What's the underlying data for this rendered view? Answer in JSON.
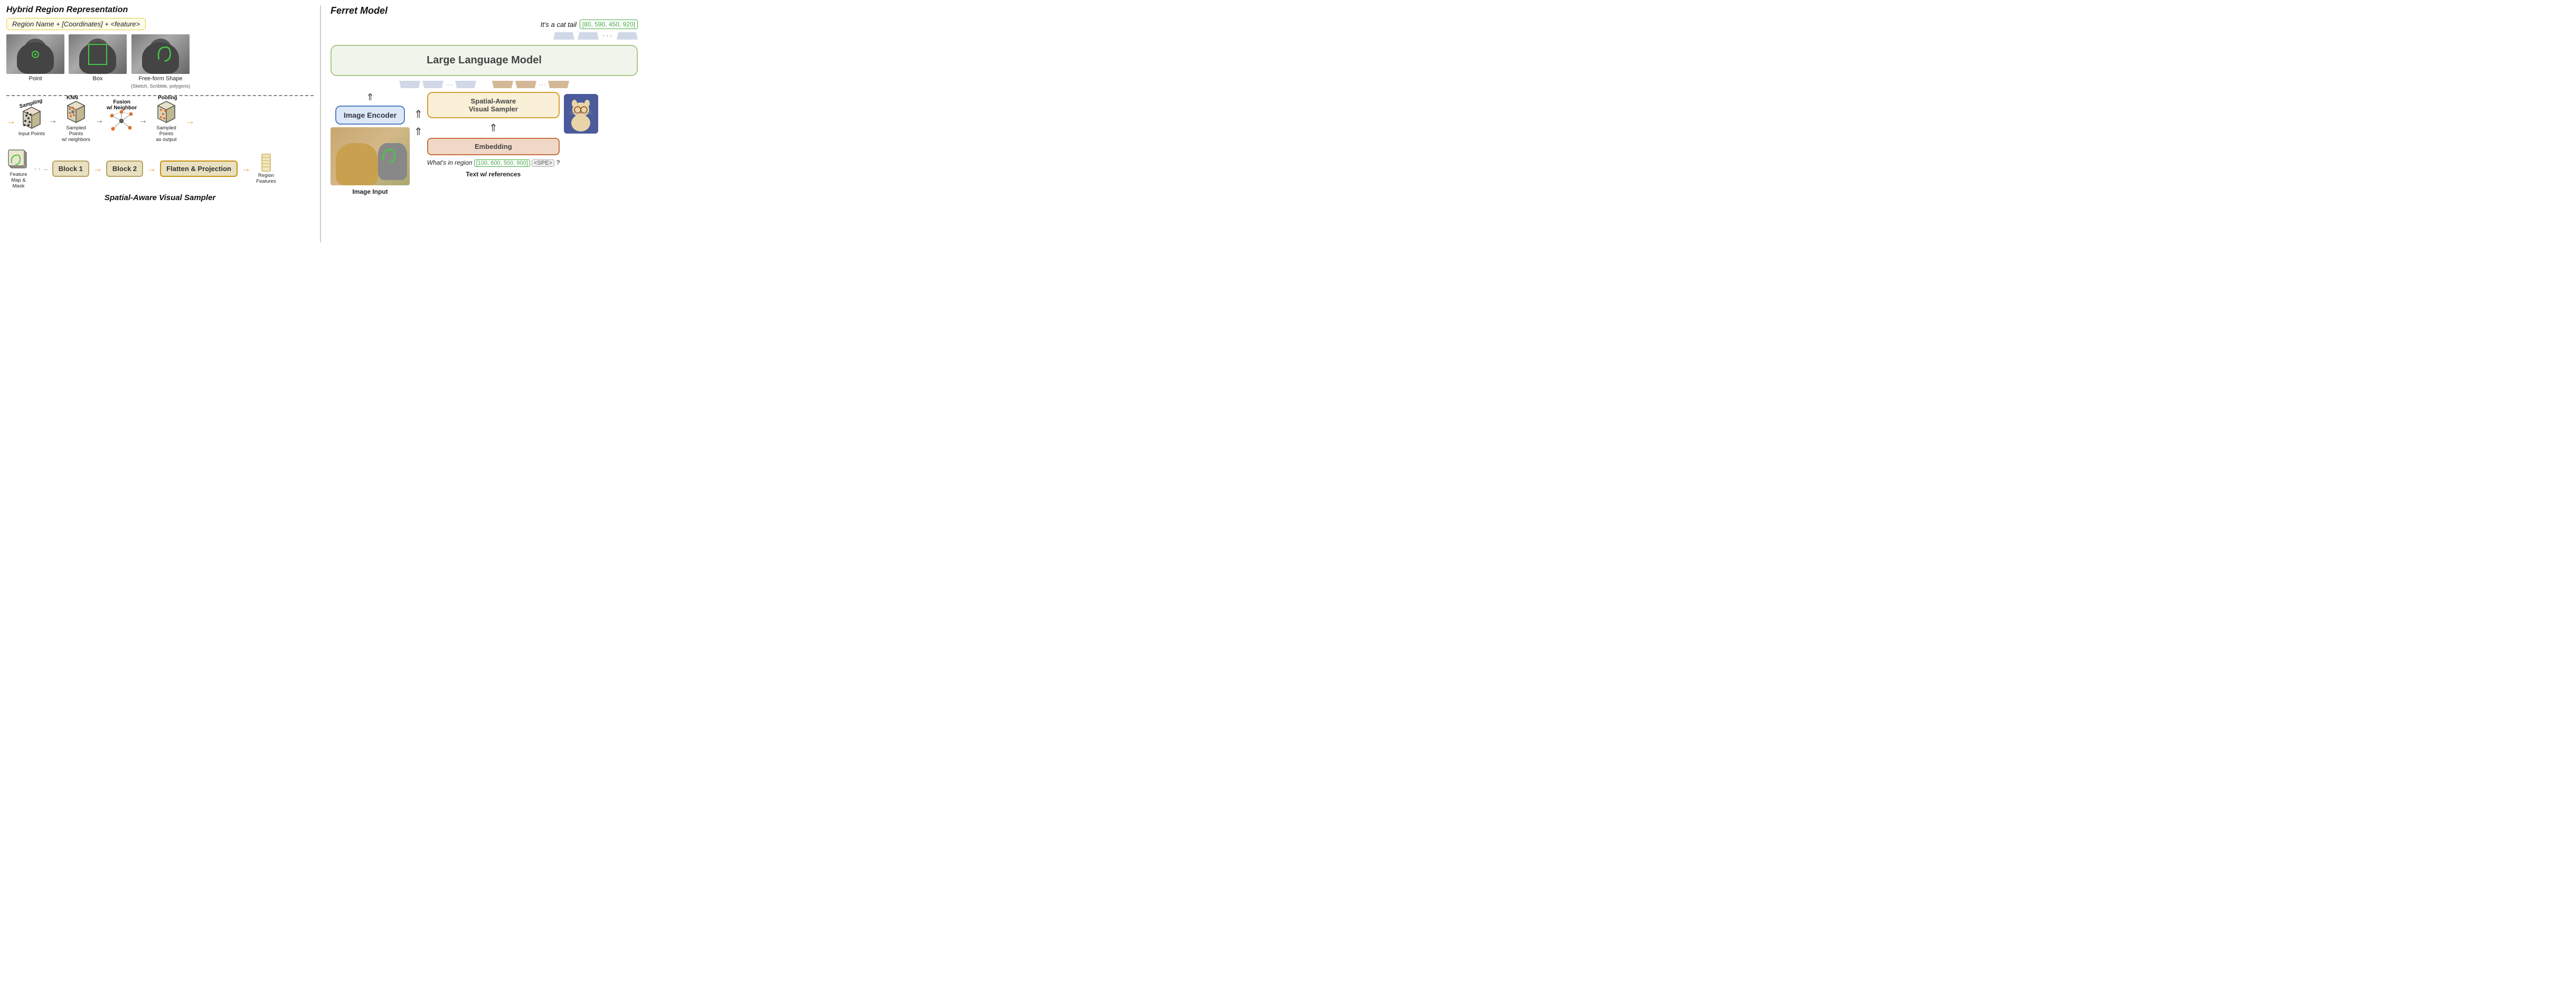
{
  "left": {
    "title": "Hybrid Region Representation",
    "formula": "Region Name + [Coordinates] + <feature>",
    "region_types": [
      {
        "label": "Point",
        "sublabel": ""
      },
      {
        "label": "Box",
        "sublabel": ""
      },
      {
        "label": "Free-form Shape",
        "sublabel": "(Sketch, Scribble, polygons)"
      }
    ],
    "diagram_labels": {
      "sampling": "Sampling",
      "knn": "KNN",
      "fusion": "Fusion\nw/ Neighbor",
      "pooling": "Pooling",
      "input_points": "Input Points",
      "sampled_points": "Sampled Points\nw/ neighbors",
      "sampled_output": "Sampled Points\nas output",
      "feature_map": "Feature Map\n& Mask"
    },
    "blocks": [
      "Block 1",
      "Block 2"
    ],
    "flatten": "Flatten &\nProjection",
    "region_features": "Region\nFeatures",
    "sampler_title": "Spatial-Aware Visual Sampler"
  },
  "right": {
    "title": "Ferret Model",
    "output_text": "It's a cat tail",
    "output_coord": "[80, 590, 450, 920]",
    "llm_label": "Large Language Model",
    "image_encoder_label": "Image Encoder",
    "spatial_sampler_label": "Spatial-Aware\nVisual Sampler",
    "embedding_label": "Embedding",
    "image_input_label": "Image Input",
    "text_ref_label": "Text w/ references",
    "text_query": "What's in region",
    "text_coord": "[100, 600, 500, 900]",
    "text_spe": "<SPE>",
    "text_question_mark": "?"
  },
  "icons": {
    "up_arrow": "⇑",
    "right_arrow": "→",
    "left_arrow": "←",
    "dots": "···"
  }
}
